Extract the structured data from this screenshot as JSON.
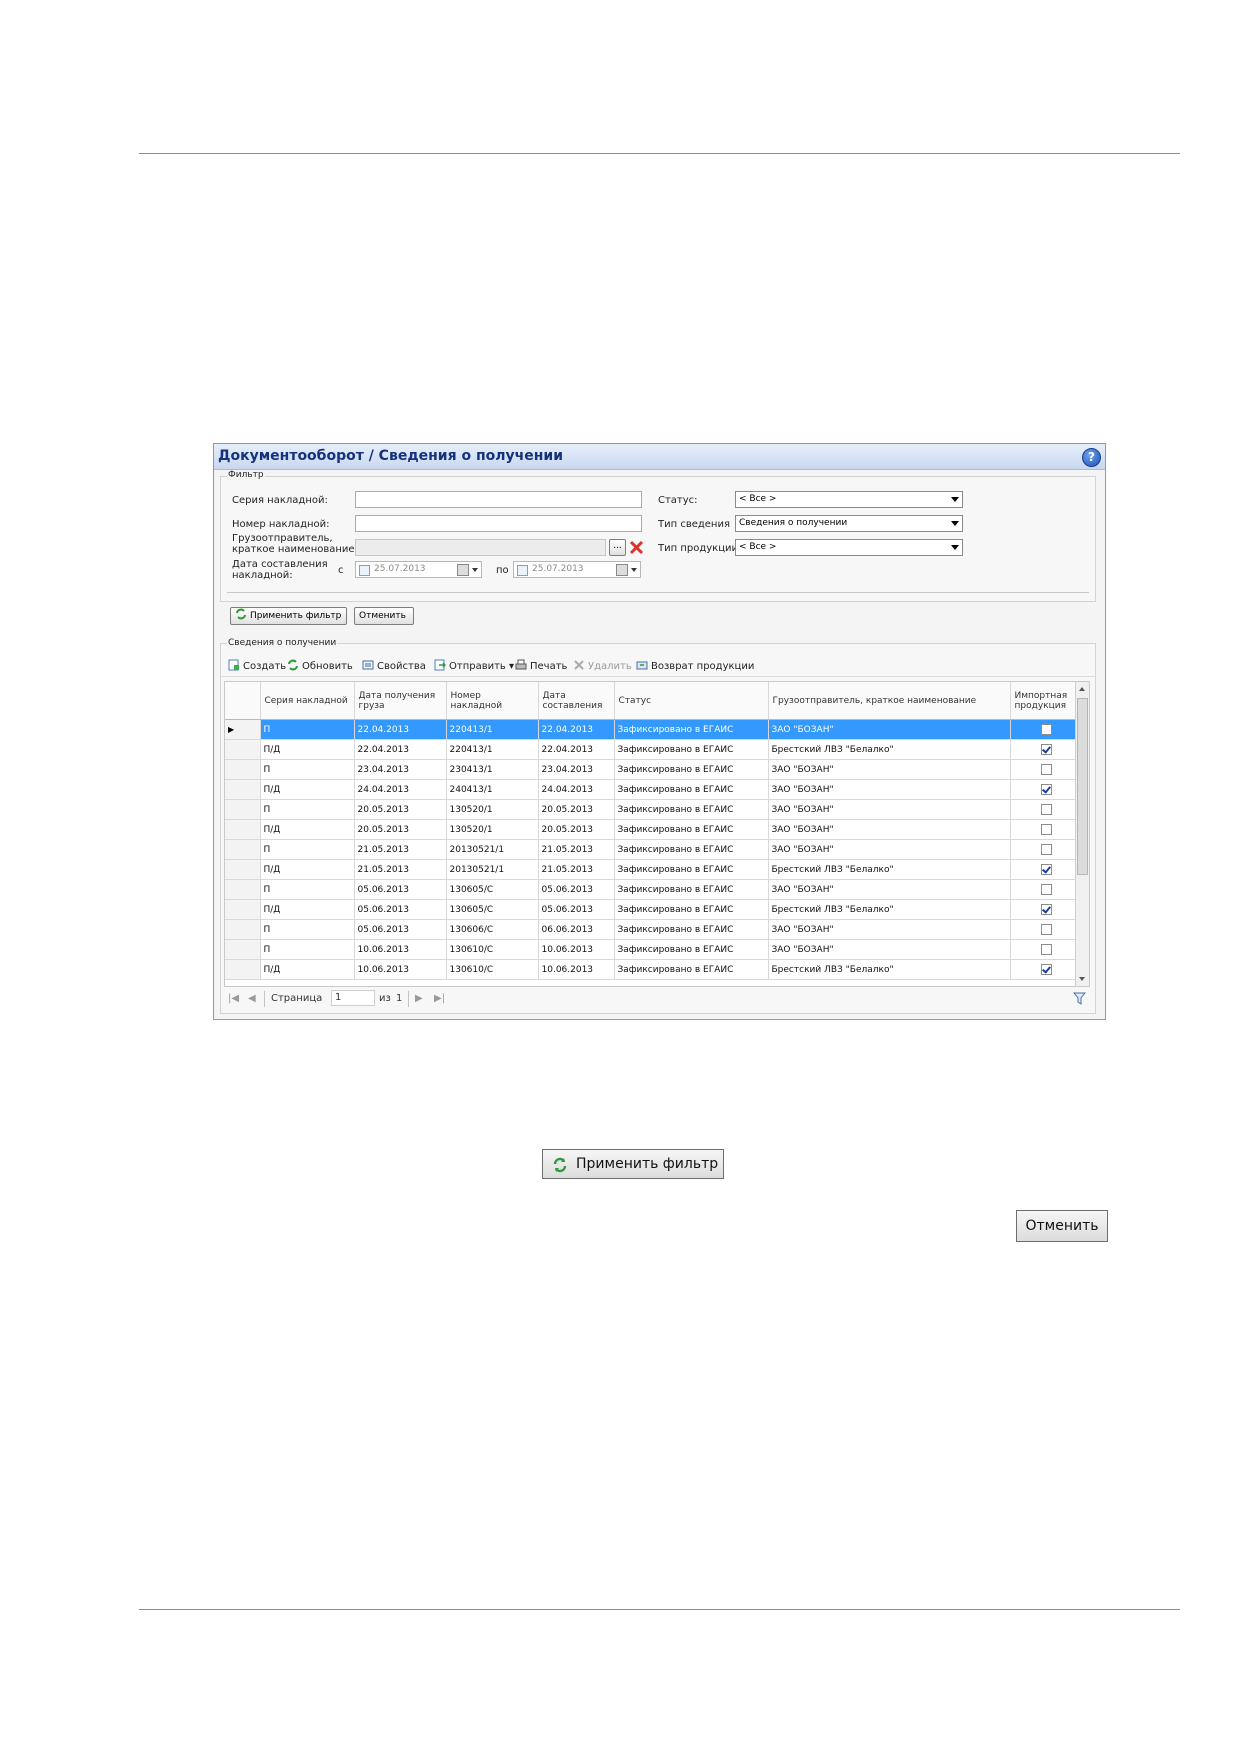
{
  "window": {
    "title": "Документооборот  / Сведения о получении"
  },
  "filter": {
    "legend": "Фильтр",
    "series_label": "Серия накладной:",
    "series_value": "",
    "number_label": "Номер накладной:",
    "number_value": "",
    "shipper_label_line1": "Грузоотправитель,",
    "shipper_label_line2": "краткое наименование:",
    "shipper_value": "",
    "browse_label": "...",
    "date_label_line1": "Дата составления",
    "date_label_line2": "накладной:",
    "date_from_label": "с",
    "date_from_value": "25.07.2013",
    "date_to_label": "по",
    "date_to_value": "25.07.2013",
    "status_label": "Статус:",
    "status_value": "< Все >",
    "info_type_label": "Тип сведения",
    "info_type_value": "Сведения о получении",
    "product_type_label": "Тип продукции:",
    "product_type_value": "< Все >",
    "apply_label": "Применить фильтр",
    "cancel_label": "Отменить"
  },
  "grid_section": {
    "legend": "Сведения о получении"
  },
  "toolbar": {
    "create": "Создать",
    "refresh": "Обновить",
    "properties": "Свойства",
    "send": "Отправить",
    "print": "Печать",
    "delete": "Удалить",
    "return": "Возврат продукции"
  },
  "grid": {
    "headers": [
      "Серия накладной",
      "Дата получения груза",
      "Номер накладной",
      "Дата составления",
      "Статус",
      "Грузоотправитель, краткое наименование",
      "Импортная продукция"
    ],
    "rows": [
      {
        "series": "П",
        "received": "22.04.2013",
        "number": "220413/1",
        "composed": "22.04.2013",
        "status": "Зафиксировано в ЕГАИС",
        "shipper": "ЗАО \"БОЗАН\"",
        "imported": false,
        "selected": true
      },
      {
        "series": "П/Д",
        "received": "22.04.2013",
        "number": "220413/1",
        "composed": "22.04.2013",
        "status": "Зафиксировано в ЕГАИС",
        "shipper": "Брестский ЛВЗ \"Белалко\"",
        "imported": true,
        "selected": false
      },
      {
        "series": "П",
        "received": "23.04.2013",
        "number": "230413/1",
        "composed": "23.04.2013",
        "status": "Зафиксировано в ЕГАИС",
        "shipper": "ЗАО \"БОЗАН\"",
        "imported": false,
        "selected": false
      },
      {
        "series": "П/Д",
        "received": "24.04.2013",
        "number": "240413/1",
        "composed": "24.04.2013",
        "status": "Зафиксировано в ЕГАИС",
        "shipper": "ЗАО \"БОЗАН\"",
        "imported": true,
        "selected": false
      },
      {
        "series": "П",
        "received": "20.05.2013",
        "number": "130520/1",
        "composed": "20.05.2013",
        "status": "Зафиксировано в ЕГАИС",
        "shipper": "ЗАО \"БОЗАН\"",
        "imported": false,
        "selected": false
      },
      {
        "series": "П/Д",
        "received": "20.05.2013",
        "number": "130520/1",
        "composed": "20.05.2013",
        "status": "Зафиксировано в ЕГАИС",
        "shipper": "ЗАО \"БОЗАН\"",
        "imported": false,
        "selected": false
      },
      {
        "series": "П",
        "received": "21.05.2013",
        "number": "20130521/1",
        "composed": "21.05.2013",
        "status": "Зафиксировано в ЕГАИС",
        "shipper": "ЗАО \"БОЗАН\"",
        "imported": false,
        "selected": false
      },
      {
        "series": "П/Д",
        "received": "21.05.2013",
        "number": "20130521/1",
        "composed": "21.05.2013",
        "status": "Зафиксировано в ЕГАИС",
        "shipper": "Брестский ЛВЗ \"Белалко\"",
        "imported": true,
        "selected": false
      },
      {
        "series": "П",
        "received": "05.06.2013",
        "number": "130605/C",
        "composed": "05.06.2013",
        "status": "Зафиксировано в ЕГАИС",
        "shipper": "ЗАО \"БОЗАН\"",
        "imported": false,
        "selected": false
      },
      {
        "series": "П/Д",
        "received": "05.06.2013",
        "number": "130605/C",
        "composed": "05.06.2013",
        "status": "Зафиксировано в ЕГАИС",
        "shipper": "Брестский ЛВЗ \"Белалко\"",
        "imported": true,
        "selected": false
      },
      {
        "series": "П",
        "received": "05.06.2013",
        "number": "130606/C",
        "composed": "06.06.2013",
        "status": "Зафиксировано в ЕГАИС",
        "shipper": "ЗАО \"БОЗАН\"",
        "imported": false,
        "selected": false
      },
      {
        "series": "П",
        "received": "10.06.2013",
        "number": "130610/C",
        "composed": "10.06.2013",
        "status": "Зафиксировано в ЕГАИС",
        "shipper": "ЗАО \"БОЗАН\"",
        "imported": false,
        "selected": false
      },
      {
        "series": "П/Д",
        "received": "10.06.2013",
        "number": "130610/C",
        "composed": "10.06.2013",
        "status": "Зафиксировано в ЕГАИС",
        "shipper": "Брестский ЛВЗ \"Белалко\"",
        "imported": true,
        "selected": false
      }
    ]
  },
  "pager": {
    "page_label": "Страница",
    "page_value": "1",
    "of_label": "из",
    "total_pages": "1"
  },
  "doc": {
    "apply_button": "Применить фильтр",
    "cancel_button": "Отменить"
  },
  "colors": {
    "selected_row": "#3399ff",
    "title_text": "#16327a",
    "clear_button": "#d9342b"
  }
}
